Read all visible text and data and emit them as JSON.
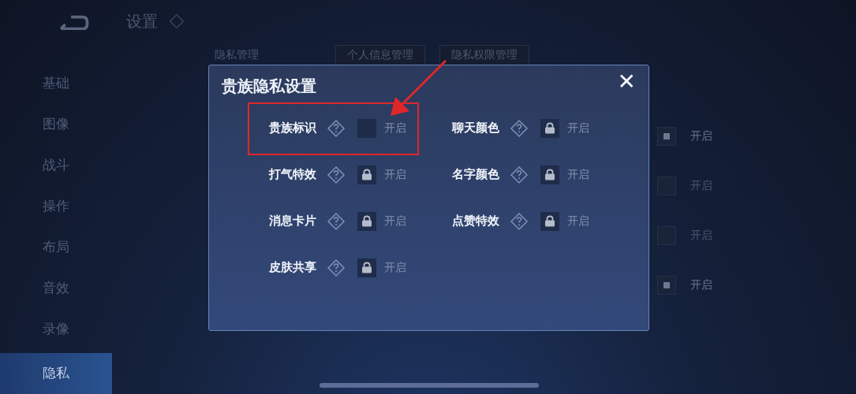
{
  "header": {
    "title": "设置"
  },
  "sidebar": {
    "items": [
      {
        "label": "基础",
        "selected": false
      },
      {
        "label": "图像",
        "selected": false
      },
      {
        "label": "战斗",
        "selected": false
      },
      {
        "label": "操作",
        "selected": false
      },
      {
        "label": "布局",
        "selected": false
      },
      {
        "label": "音效",
        "selected": false
      },
      {
        "label": "录像",
        "selected": false
      },
      {
        "label": "隐私",
        "selected": true
      }
    ]
  },
  "privacy": {
    "label": "隐私管理",
    "buttons": [
      "个人信息管理",
      "隐私权限管理"
    ],
    "toggles": [
      {
        "checked": true,
        "label": "开启"
      },
      {
        "checked": false,
        "label": "开启"
      },
      {
        "checked": false,
        "label": "开启"
      },
      {
        "checked": true,
        "label": "开启"
      }
    ]
  },
  "dialog": {
    "title": "贵族隐私设置",
    "close": "✕",
    "options": [
      {
        "label": "贵族标识",
        "locked": false,
        "highlighted": true,
        "state": "开启"
      },
      {
        "label": "聊天颜色",
        "locked": true,
        "highlighted": false,
        "state": "开启"
      },
      {
        "label": "打气特效",
        "locked": true,
        "highlighted": false,
        "state": "开启"
      },
      {
        "label": "名字颜色",
        "locked": true,
        "highlighted": false,
        "state": "开启"
      },
      {
        "label": "消息卡片",
        "locked": true,
        "highlighted": false,
        "state": "开启"
      },
      {
        "label": "点赞特效",
        "locked": true,
        "highlighted": false,
        "state": "开启"
      },
      {
        "label": "皮肤共享",
        "locked": true,
        "highlighted": false,
        "state": "开启"
      }
    ]
  }
}
